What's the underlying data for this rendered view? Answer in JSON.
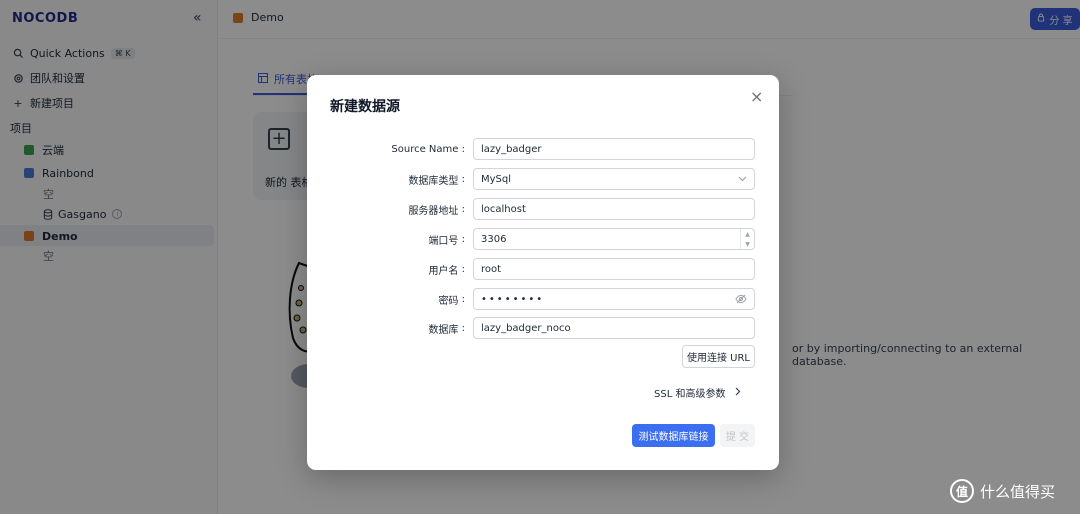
{
  "app": {
    "logo": "NOCODB",
    "collapse": "«"
  },
  "sidebar": {
    "quick_actions": "Quick Actions",
    "shortcut": "⌘ K",
    "team": "团队和设置",
    "new_project": "新建项目",
    "section_label": "项目",
    "items": [
      {
        "label": "云端",
        "color": "#3fa34d"
      },
      {
        "label": "Rainbond",
        "color": "#4a7fd6"
      },
      {
        "label": "空"
      },
      {
        "label": "Gasgano"
      },
      {
        "label": "Demo",
        "color": "#d97a2b"
      },
      {
        "label": "空"
      }
    ]
  },
  "header": {
    "breadcrumb": "Demo",
    "share": "分 享"
  },
  "background": {
    "tab": "所有表格",
    "card_label": "新的 表格",
    "description": "or by importing/connecting to an external database."
  },
  "modal": {
    "title": "新建数据源",
    "close": "×",
    "fields": {
      "source_name": {
        "label": "Source Name",
        "value": "lazy_badger"
      },
      "db_type": {
        "label": "数据库类型",
        "value": "MySql"
      },
      "host": {
        "label": "服务器地址",
        "value": "localhost"
      },
      "port": {
        "label": "端口号",
        "value": "3306"
      },
      "user": {
        "label": "用户名",
        "value": "root"
      },
      "password": {
        "label": "密码",
        "value": "••••••••"
      },
      "database": {
        "label": "数据库",
        "value": "lazy_badger_noco"
      }
    },
    "use_url": "使用连接 URL",
    "ssl": "SSL 和高级参数",
    "test": "测试数据库链接",
    "submit": "提 交"
  },
  "watermark": {
    "icon": "值",
    "text": "什么值得买"
  }
}
